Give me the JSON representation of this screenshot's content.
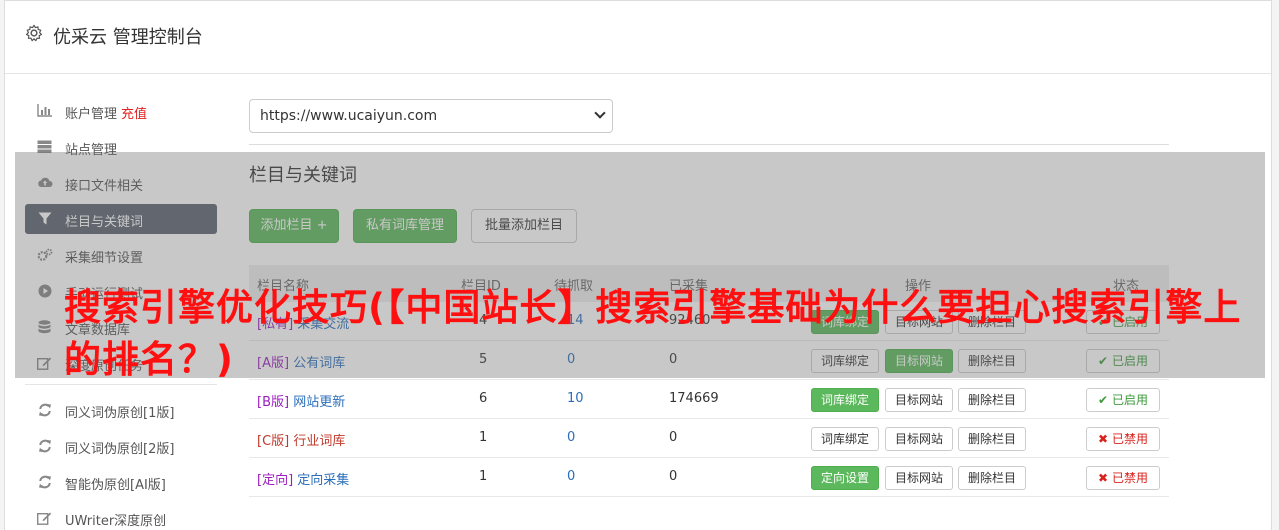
{
  "header": {
    "title": "优采云 管理控制台",
    "icon": "gear-icon"
  },
  "sidebar": {
    "items": [
      {
        "label": "账户管理",
        "extra": "充值",
        "icon": "bar-chart-icon"
      },
      {
        "label": "站点管理",
        "icon": "server-icon"
      },
      {
        "label": "接口文件相关",
        "icon": "cloud-upload-icon"
      },
      {
        "label": "栏目与关键词",
        "icon": "filter-icon",
        "active": true
      },
      {
        "label": "采集细节设置",
        "icon": "cogs-icon"
      },
      {
        "label": "手动运行测试",
        "icon": "play-circle-icon"
      },
      {
        "label": "文章数据库",
        "icon": "database-icon"
      },
      {
        "label": "深度原创任务",
        "icon": "edit-icon"
      }
    ],
    "items2": [
      {
        "label": "同义词伪原创[1版]",
        "icon": "refresh-icon"
      },
      {
        "label": "同义词伪原创[2版]",
        "icon": "refresh-icon"
      },
      {
        "label": "智能伪原创[AI版]",
        "icon": "refresh-icon"
      },
      {
        "label": "UWriter深度原创",
        "icon": "edit-icon"
      }
    ]
  },
  "main": {
    "site_select": "https://www.ucaiyun.com",
    "section_title": "栏目与关键词",
    "buttons": {
      "add": "添加栏目 +",
      "private_lib": "私有词库管理",
      "batch_add": "批量添加栏目"
    },
    "table": {
      "headers": [
        "栏目名称",
        "栏目ID",
        "待抓取",
        "已采集",
        "操作",
        "状态"
      ],
      "rows": [
        {
          "tag": "[私有]",
          "name": "采集交流",
          "id": "4",
          "pending": "14",
          "collected": "92460",
          "op1": "词库绑定",
          "op2": "目标网站",
          "op3": "删除栏目",
          "status": "已启用",
          "on": true,
          "op1green": true
        },
        {
          "tag": "[A版]",
          "name": "公有词库",
          "id": "5",
          "pending": "0",
          "collected": "0",
          "op1": "词库绑定",
          "op2": "目标网站",
          "op3": "删除栏目",
          "status": "已启用",
          "on": true,
          "op2green": true
        },
        {
          "tag": "[B版]",
          "name": "网站更新",
          "id": "6",
          "pending": "10",
          "collected": "174669",
          "op1": "词库绑定",
          "op2": "目标网站",
          "op3": "删除栏目",
          "status": "已启用",
          "on": true,
          "op1green": true
        },
        {
          "tag": "[C版]",
          "name": "行业词库",
          "id": "1",
          "pending": "0",
          "collected": "0",
          "op1": "词库绑定",
          "op2": "目标网站",
          "op3": "删除栏目",
          "status": "已禁用",
          "on": false
        },
        {
          "tag": "[定向]",
          "name": "定向采集",
          "id": "1",
          "pending": "0",
          "collected": "0",
          "op1": "定向设置",
          "op2": "目标网站",
          "op3": "删除栏目",
          "status": "已禁用",
          "on": false,
          "op1green": true
        }
      ]
    }
  },
  "overlay_banner": "搜索引擎优化技巧(【中国站长】搜索引擎基础为什么要担心搜索引擎上的排名？)",
  "colors": {
    "green": "#5cb85c",
    "active_nav": "#5a6270",
    "banner_red": "#ff1010",
    "disabled_red": "#d9231e"
  }
}
